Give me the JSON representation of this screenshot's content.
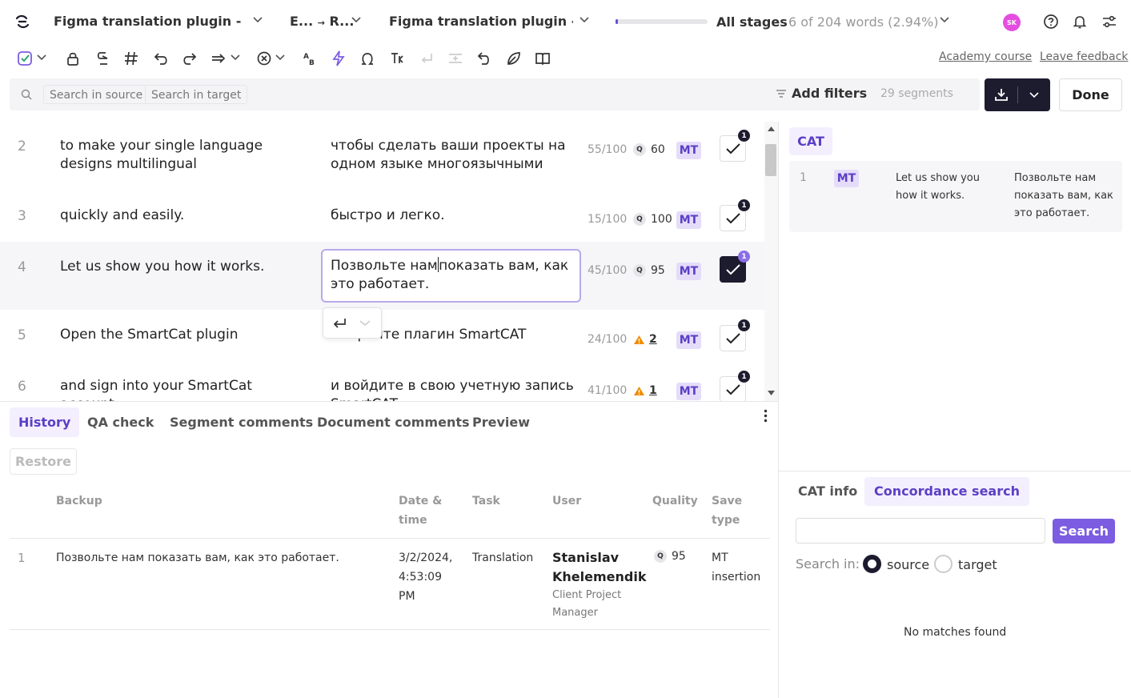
{
  "header": {
    "doc_title_1": "Figma translation plugin - Sm...",
    "lang_pair_from": "E...",
    "lang_pair_arrow": "→",
    "lang_pair_to": "R...",
    "doc_title_2": "Figma translation plugin - Sma",
    "progress_fraction": 0.03,
    "stages_label": "All stages",
    "words_label": "6 of 204 words  (2.94%)",
    "avatar_initials": "SK"
  },
  "toolbar": {
    "academy_link": "Academy course",
    "feedback_link": "Leave feedback"
  },
  "search": {
    "source_placeholder": "Search in source",
    "target_placeholder": "Search in target",
    "filters_label": "Add filters",
    "segments_count": "29 segments",
    "done_label": "Done"
  },
  "segments": [
    {
      "num": "2",
      "source": "to make your single language designs multilingual",
      "target": "чтобы сделать ваши проекты на одном языке многоязычными",
      "score": "55/100",
      "quality": "60",
      "tag": "MT",
      "badge": "1"
    },
    {
      "num": "3",
      "source": "quickly and easily.",
      "target": "быстро и легко.",
      "score": "15/100",
      "quality": "100",
      "tag": "MT",
      "badge": "1"
    },
    {
      "num": "4",
      "source": "Let us show you how it works.",
      "target_before": "Позвольте нам",
      "target_after": "показать вам, как это работает.",
      "score": "45/100",
      "quality": "95",
      "tag": "MT",
      "badge": "1"
    },
    {
      "num": "5",
      "source": "Open the SmartCat plugin",
      "target": "Откройте плагин SmartCAT",
      "score": "24/100",
      "warnings": "2",
      "tag": "MT",
      "badge": "1"
    },
    {
      "num": "6",
      "source": "and sign into your SmartCat account.",
      "target": "и войдите в свою учетную запись SmartCAT.",
      "score": "41/100",
      "warnings": "1",
      "tag": "MT",
      "badge": "1"
    }
  ],
  "bottom": {
    "tabs": [
      "History",
      "QA check",
      "Segment comments",
      "Document comments",
      "Preview"
    ],
    "restore_label": "Restore",
    "columns": {
      "backup": "Backup",
      "date_1": "Date &",
      "date_2": "time",
      "task": "Task",
      "user": "User",
      "quality": "Quality",
      "save_1": "Save",
      "save_2": "type"
    },
    "row": {
      "num": "1",
      "backup": "Позвольте нам показать вам, как это работает.",
      "date_1": "3/2/2024,",
      "date_2": "4:53:09",
      "date_3": "PM",
      "task": "Translation",
      "user_1": "Stanislav",
      "user_2": "Khelemendik",
      "role_1": "Client Project",
      "role_2": "Manager",
      "quality": "95",
      "save_1": "MT",
      "save_2": "insertion"
    }
  },
  "right": {
    "cat_tab": "CAT",
    "cat_match": {
      "num": "1",
      "tag": "MT",
      "source_1": "Let us show you",
      "source_2": "how it works.",
      "target_1": "Позвольте нам",
      "target_2": "показать вам, как",
      "target_3": "это работает."
    },
    "tabs": [
      "CAT info",
      "Concordance search"
    ],
    "search_button": "Search",
    "search_in_label": "Search in:",
    "source_option": "source",
    "target_option": "target",
    "no_matches": "No matches found"
  },
  "colors": {
    "accent": "#7c5ce0",
    "accent_light": "#f3effe",
    "dark": "#1d1b2e",
    "warning": "#f08c00"
  }
}
